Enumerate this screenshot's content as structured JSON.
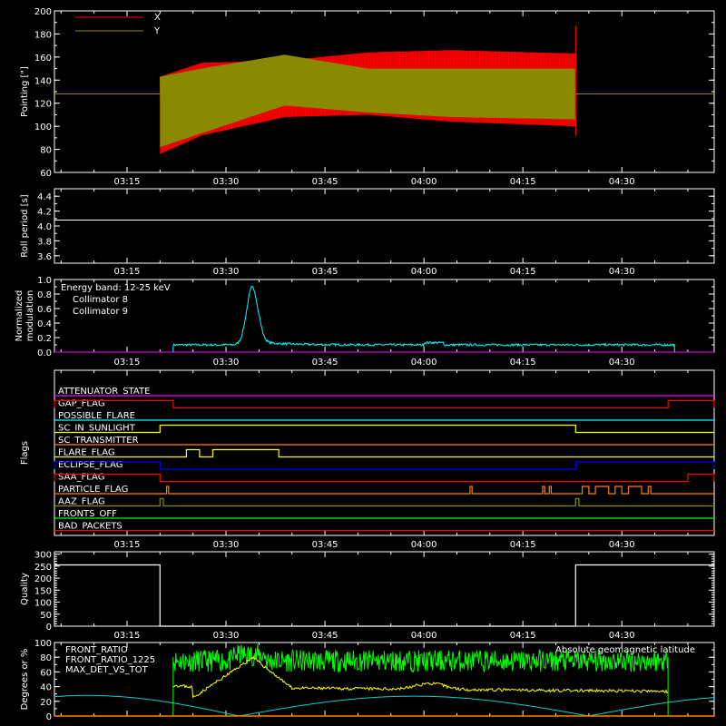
{
  "colors": {
    "background": "#000000",
    "foreground": "#ffffff",
    "red": "#ff0000",
    "olive": "#8a8a00",
    "cyan": "#00ffff",
    "magenta": "#ff00ff",
    "yellow": "#ffff00",
    "orange": "#ff7f00",
    "green": "#00ff00",
    "blue": "#0000ff",
    "teal": "#00cfcf"
  },
  "chart_data": [
    {
      "type": "line",
      "ylabel": "Pointing [\"]",
      "ylim": [
        60,
        200
      ],
      "yticks": [
        "60",
        "80",
        "100",
        "120",
        "140",
        "160",
        "180",
        "200"
      ],
      "xlim": [
        "03:04",
        "04:44"
      ],
      "xticks": [
        "03:15",
        "03:30",
        "03:45",
        "04:00",
        "04:15",
        "04:30"
      ],
      "legend": "top-left",
      "series": [
        {
          "name": "X",
          "color": "#ff0000",
          "time_range": [
            "03:20",
            "04:23"
          ],
          "lower_envelope": [
            [
              0,
              76
            ],
            [
              0.1,
              92
            ],
            [
              0.3,
              108
            ],
            [
              0.5,
              110
            ],
            [
              0.7,
              104
            ],
            [
              1,
              100
            ]
          ],
          "upper_envelope": [
            [
              0,
              143
            ],
            [
              0.1,
              155
            ],
            [
              0.3,
              157
            ],
            [
              0.5,
              164
            ],
            [
              0.7,
              166
            ],
            [
              1,
              163
            ]
          ]
        },
        {
          "name": "Y",
          "color": "#8a8a00",
          "baseline": 128,
          "time_range": [
            "03:20",
            "04:23"
          ],
          "lower_envelope": [
            [
              0,
              82
            ],
            [
              0.1,
              94
            ],
            [
              0.3,
              118
            ],
            [
              0.5,
              112
            ],
            [
              0.7,
              108
            ],
            [
              1,
              106
            ]
          ],
          "upper_envelope": [
            [
              0,
              143
            ],
            [
              0.1,
              150
            ],
            [
              0.3,
              162
            ],
            [
              0.5,
              150
            ],
            [
              0.7,
              150
            ],
            [
              1,
              150
            ]
          ]
        }
      ]
    },
    {
      "type": "line",
      "ylabel": "Roll period [s]",
      "ylim": [
        3.5,
        4.5
      ],
      "yticks": [
        "3.6",
        "3.8",
        "4.0",
        "4.2",
        "4.4"
      ],
      "xticks": [
        "03:15",
        "03:30",
        "03:45",
        "04:00",
        "04:15",
        "04:30"
      ],
      "series": [
        {
          "color": "#ffffff",
          "value": 4.08
        }
      ]
    },
    {
      "type": "line",
      "ylabel": "Normalized modulation",
      "ylim": [
        0.0,
        1.0
      ],
      "yticks": [
        "0.0",
        "0.2",
        "0.4",
        "0.6",
        "0.8",
        "1.0"
      ],
      "xticks": [
        "03:15",
        "03:30",
        "03:45",
        "04:00",
        "04:15",
        "04:30"
      ],
      "annotation": "Energy band: 12-25 keV",
      "legend": "top-left",
      "series": [
        {
          "name": "Collimator 8",
          "color": "#00ffff",
          "time_range": [
            "03:22",
            "04:38"
          ],
          "base": 0.1,
          "peak_time": "03:34",
          "peak_value": 0.9
        },
        {
          "name": "Collimator 9",
          "color": "#ff00ff",
          "value": 0.0
        }
      ]
    },
    {
      "type": "line",
      "ylabel": "Flags",
      "xticks": [
        "03:15",
        "03:30",
        "03:45",
        "04:00",
        "04:15",
        "04:30"
      ],
      "flags": [
        {
          "name": "ATTENUATOR_STATE",
          "color": "#ff00ff",
          "on": []
        },
        {
          "name": "GAP_FLAG",
          "color": "#ff0000",
          "on": [
            [
              "03:04",
              "03:22"
            ],
            [
              "04:37",
              "04:44"
            ]
          ]
        },
        {
          "name": "POSSIBLE_FLARE",
          "color": "#00ffff",
          "on": []
        },
        {
          "name": "SC_IN_SUNLIGHT",
          "color": "#ffff00",
          "on": [
            [
              "03:20",
              "04:23"
            ]
          ]
        },
        {
          "name": "SC_TRANSMITTER",
          "color": "#ff7f00",
          "on": []
        },
        {
          "name": "FLARE_FLAG",
          "color": "#ffff00",
          "on": [
            [
              "03:24",
              "03:26"
            ],
            [
              "03:28",
              "03:38"
            ]
          ]
        },
        {
          "name": "ECLIPSE_FLAG",
          "color": "#0000ff",
          "on": [
            [
              "03:04",
              "03:20"
            ],
            [
              "04:23",
              "04:44"
            ]
          ]
        },
        {
          "name": "SAA_FLAG",
          "color": "#ff0000",
          "on": [
            [
              "03:04",
              "03:20"
            ],
            [
              "04:40",
              "04:44"
            ]
          ]
        },
        {
          "name": "PARTICLE_FLAG",
          "color": "#ff7f00",
          "on": [
            [
              "03:21",
              "03:21.3"
            ],
            [
              "04:07",
              "04:07.3"
            ],
            [
              "04:18",
              "04:18.3"
            ],
            [
              "04:19",
              "04:19.3"
            ],
            [
              "04:24",
              "04:25"
            ],
            [
              "04:26",
              "04:28"
            ],
            [
              "04:29",
              "04:30"
            ],
            [
              "04:31",
              "04:33"
            ],
            [
              "04:34",
              "04:34.4"
            ]
          ]
        },
        {
          "name": "AAZ_FLAG",
          "color": "#8a8a00",
          "on": [
            [
              "03:20",
              "03:20.5"
            ],
            [
              "04:23",
              "04:23.5"
            ]
          ]
        },
        {
          "name": "FRONTS_OFF",
          "color": "#00ff00",
          "on": []
        },
        {
          "name": "BAD_PACKETS",
          "color": "#ff0000",
          "on": []
        }
      ]
    },
    {
      "type": "line",
      "ylabel": "Quality",
      "ylim": [
        0,
        310
      ],
      "yticks": [
        "0",
        "50",
        "100",
        "150",
        "200",
        "250",
        "300"
      ],
      "xticks": [
        "03:15",
        "03:30",
        "03:45",
        "04:00",
        "04:15",
        "04:30"
      ],
      "series": [
        {
          "color": "#ffffff",
          "points": [
            [
              "03:04",
              255
            ],
            [
              "03:20",
              255
            ],
            [
              "03:20",
              0
            ],
            [
              "04:23",
              0
            ],
            [
              "04:23",
              255
            ],
            [
              "04:44",
              255
            ]
          ]
        }
      ]
    },
    {
      "type": "line",
      "ylabel": "Degrees or %",
      "ylim": [
        0,
        100
      ],
      "yticks": [
        "0",
        "20",
        "40",
        "60",
        "80",
        "100"
      ],
      "xticks": [
        "03:15",
        "03:30",
        "03:45",
        "04:00",
        "04:15",
        "04:30"
      ],
      "legend": "top-left",
      "series": [
        {
          "name": "FRONT_RATIO",
          "color": "#ffff00",
          "time_range": [
            "03:22",
            "04:37"
          ]
        },
        {
          "name": "FRONT_RATIO_1225",
          "color": "#00ff00",
          "time_range": [
            "03:22",
            "04:37"
          ]
        },
        {
          "name": "MAX_DET_VS_TOT",
          "color": "#ff7f00",
          "value": 0
        },
        {
          "name": "Absolute geomagnetic latitude",
          "color": "#00cfcf",
          "legend_position": "top-right"
        }
      ]
    }
  ]
}
